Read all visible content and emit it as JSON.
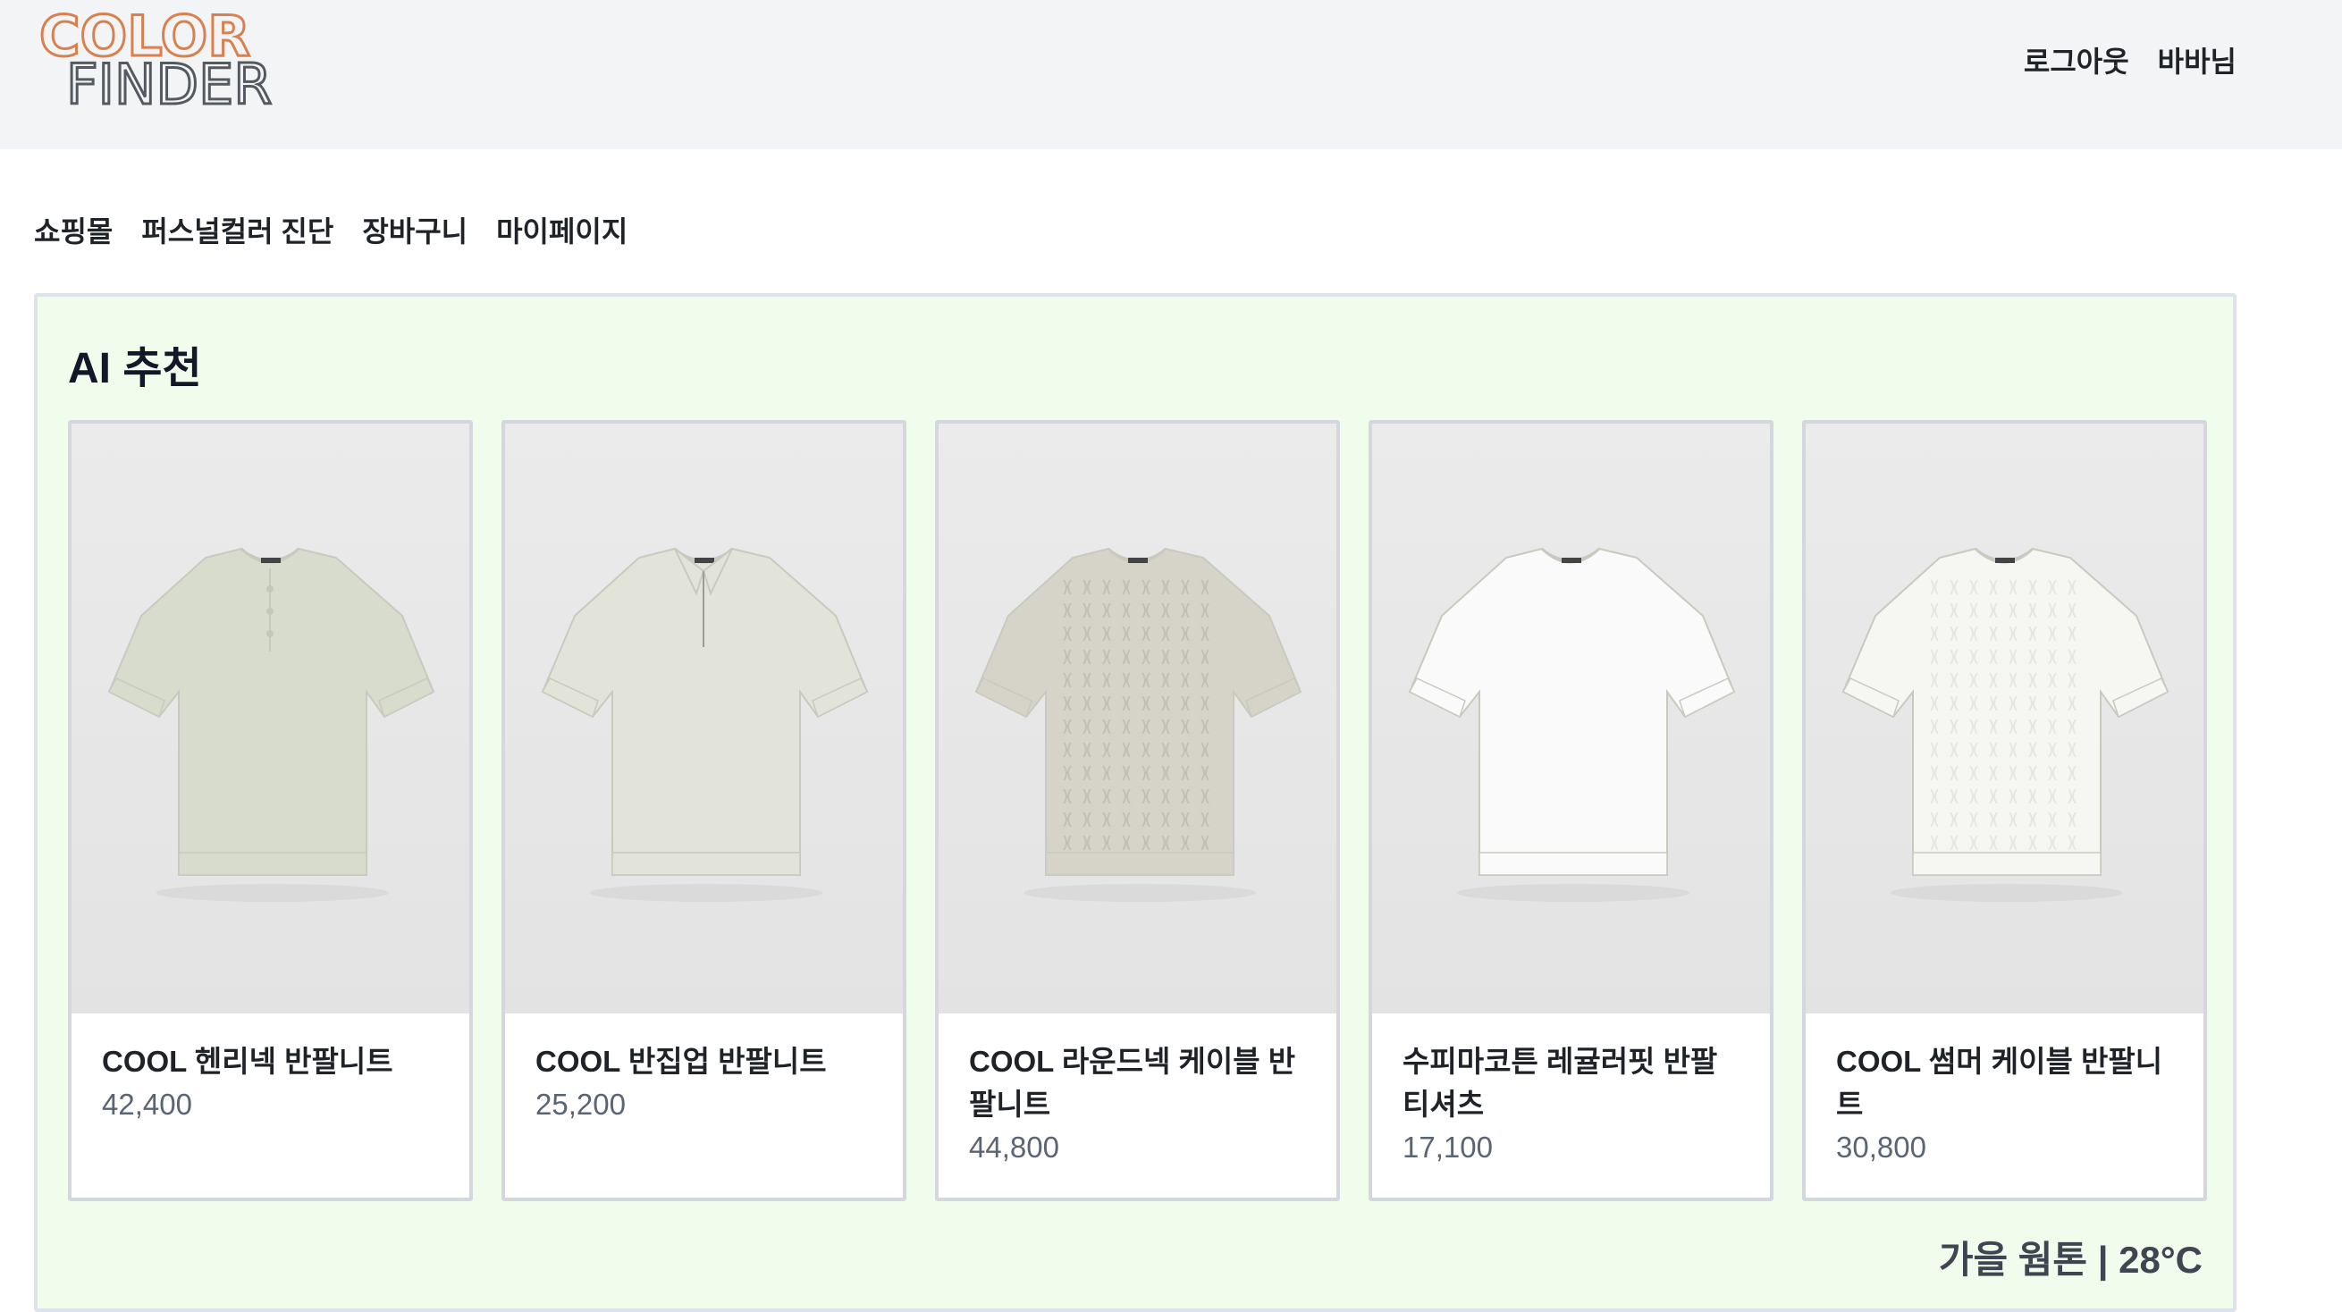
{
  "logo": {
    "line1": "COLOR",
    "line2": "FINDER"
  },
  "header": {
    "logout_label": "로그아웃",
    "user_label": "바바님"
  },
  "nav": {
    "items": [
      "쇼핑몰",
      "퍼스널컬러 진단",
      "장바구니",
      "마이페이지"
    ]
  },
  "panel": {
    "title": "AI 추천",
    "footer": "가을 웜톤 | 28°C"
  },
  "products": [
    {
      "name": "COOL 헨리넥 반팔니트",
      "price": "42,400",
      "color": "#d7dccd",
      "icon": "henley-shirt-image"
    },
    {
      "name": "COOL 반집업 반팔니트",
      "price": "25,200",
      "color": "#e2e4d9",
      "icon": "polo-shirt-image"
    },
    {
      "name": "COOL 라운드넥 케이블 반팔니트",
      "price": "44,800",
      "color": "#d6d4c8",
      "icon": "cable-knit-image"
    },
    {
      "name": "수피마코튼 레귤러핏 반팔티셔츠",
      "price": "17,100",
      "color": "#fafafa",
      "icon": "tshirt-image"
    },
    {
      "name": "COOL 썸머 케이블 반팔니트",
      "price": "30,800",
      "color": "#f6f6f3",
      "icon": "summer-knit-image"
    }
  ]
}
